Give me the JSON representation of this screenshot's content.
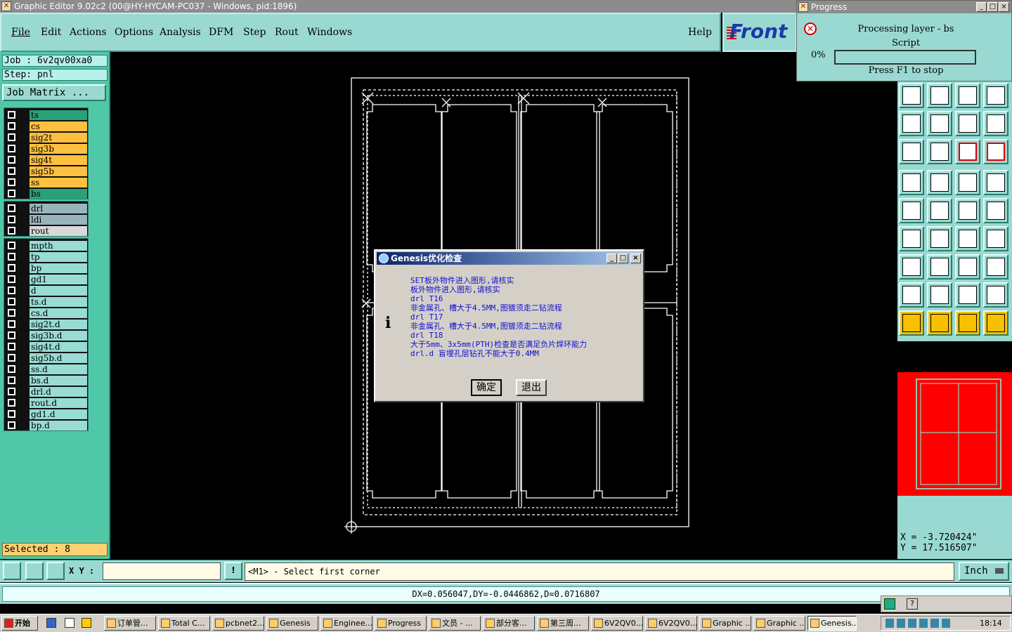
{
  "window": {
    "title": "Graphic Editor 9.02c2 (00@HY-HYCAM-PC037 - Windows, pid:1896)"
  },
  "menu": {
    "items": [
      "File",
      "Edit",
      "Actions",
      "Options",
      "Analysis",
      "DFM",
      "Step",
      "Rout",
      "Windows"
    ],
    "help": "Help"
  },
  "logo": {
    "text": "Front"
  },
  "progress": {
    "title": "Progress",
    "line1": "Processing layer - bs",
    "line2": "Script",
    "percent": "0%",
    "value": 0,
    "hint": "Press F1 to stop"
  },
  "job": {
    "job": "Job : 6v2qv00xa0",
    "step": "Step: pnl",
    "matrix_button": "Job Matrix ..."
  },
  "layers": {
    "group1": [
      {
        "name": "ts",
        "color": "#2aa078"
      },
      {
        "name": "cs",
        "color": "#ffc040"
      },
      {
        "name": "sig2t",
        "color": "#ffc040"
      },
      {
        "name": "sig3b",
        "color": "#ffc040"
      },
      {
        "name": "sig4t",
        "color": "#ffc040"
      },
      {
        "name": "sig5b",
        "color": "#ffc040"
      },
      {
        "name": "ss",
        "color": "#ffc040"
      },
      {
        "name": "bs",
        "color": "#2aa078"
      }
    ],
    "group2": [
      {
        "name": "drl",
        "color": "#98b4bc"
      },
      {
        "name": "ldi",
        "color": "#98b4bc"
      },
      {
        "name": "rout",
        "color": "#d8d8d8"
      }
    ],
    "group3": [
      {
        "name": "mpth",
        "color": "#98dcd4"
      },
      {
        "name": "tp",
        "color": "#98dcd4"
      },
      {
        "name": "bp",
        "color": "#98dcd4"
      },
      {
        "name": "gd1",
        "color": "#98dcd4"
      },
      {
        "name": "d",
        "color": "#98dcd4"
      },
      {
        "name": "ts.d",
        "color": "#98dcd4"
      },
      {
        "name": "cs.d",
        "color": "#98dcd4"
      },
      {
        "name": "sig2t.d",
        "color": "#98dcd4"
      },
      {
        "name": "sig3b.d",
        "color": "#98dcd4"
      },
      {
        "name": "sig4t.d",
        "color": "#98dcd4"
      },
      {
        "name": "sig5b.d",
        "color": "#98dcd4"
      },
      {
        "name": "ss.d",
        "color": "#98dcd4"
      },
      {
        "name": "bs.d",
        "color": "#98dcd4"
      },
      {
        "name": "drl.d",
        "color": "#98dcd4"
      },
      {
        "name": "rout.d",
        "color": "#98dcd4"
      },
      {
        "name": "gd1.d",
        "color": "#98dcd4"
      },
      {
        "name": "bp.d",
        "color": "#98dcd4"
      }
    ]
  },
  "selected": "Selected : 8",
  "coords": {
    "x": "X  =  -3.720424\"",
    "y": "Y  =  17.516507\""
  },
  "command": {
    "xy_label": "X Y :",
    "xy_value": "",
    "prompt": "<M1> - Select first corner",
    "units": "Inch"
  },
  "status": "DX=0.056047,DY=-0.0446862,D=0.0716807",
  "dialog": {
    "title": "Genesis优化检查",
    "lines": [
      "SET板外物件进入图形,请核实",
      "板外物件进入图形,请核实",
      "drl T16",
      "非金属孔、槽大于4.5MM,图镀须走二钻流程",
      "drl T17",
      "非金属孔、槽大于4.5MM,图镀须走二钻流程",
      "drl T18",
      "大于5mm、3x5mm(PTH)检查是否满足负片焊环能力",
      "drl.d 盲埋孔层钻孔不能大于0.4MM"
    ],
    "ok": "确定",
    "exit": "退出"
  },
  "taskbar": {
    "start": "开始",
    "tasks": [
      "订单管...",
      "Total C...",
      "pcbnet2...",
      "Genesis",
      "Enginee...",
      "Progress",
      "文员 - ...",
      "部分客...",
      "第三周...",
      "6V2QV0...",
      "6V2QV0...",
      "Graphic ...",
      "Graphic ...",
      "Genesis..."
    ],
    "clock": "18:14"
  }
}
